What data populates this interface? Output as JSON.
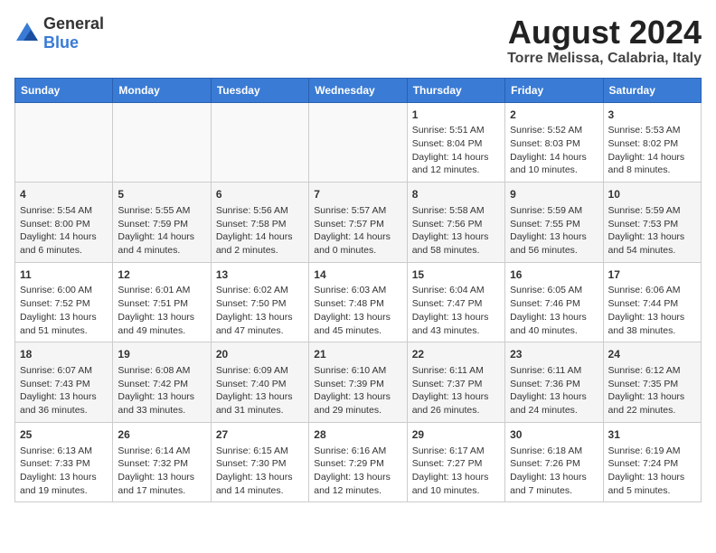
{
  "logo": {
    "general": "General",
    "blue": "Blue"
  },
  "title": "August 2024",
  "subtitle": "Torre Melissa, Calabria, Italy",
  "days_of_week": [
    "Sunday",
    "Monday",
    "Tuesday",
    "Wednesday",
    "Thursday",
    "Friday",
    "Saturday"
  ],
  "weeks": [
    [
      {
        "day": "",
        "content": ""
      },
      {
        "day": "",
        "content": ""
      },
      {
        "day": "",
        "content": ""
      },
      {
        "day": "",
        "content": ""
      },
      {
        "day": "1",
        "content": "Sunrise: 5:51 AM\nSunset: 8:04 PM\nDaylight: 14 hours\nand 12 minutes."
      },
      {
        "day": "2",
        "content": "Sunrise: 5:52 AM\nSunset: 8:03 PM\nDaylight: 14 hours\nand 10 minutes."
      },
      {
        "day": "3",
        "content": "Sunrise: 5:53 AM\nSunset: 8:02 PM\nDaylight: 14 hours\nand 8 minutes."
      }
    ],
    [
      {
        "day": "4",
        "content": "Sunrise: 5:54 AM\nSunset: 8:00 PM\nDaylight: 14 hours\nand 6 minutes."
      },
      {
        "day": "5",
        "content": "Sunrise: 5:55 AM\nSunset: 7:59 PM\nDaylight: 14 hours\nand 4 minutes."
      },
      {
        "day": "6",
        "content": "Sunrise: 5:56 AM\nSunset: 7:58 PM\nDaylight: 14 hours\nand 2 minutes."
      },
      {
        "day": "7",
        "content": "Sunrise: 5:57 AM\nSunset: 7:57 PM\nDaylight: 14 hours\nand 0 minutes."
      },
      {
        "day": "8",
        "content": "Sunrise: 5:58 AM\nSunset: 7:56 PM\nDaylight: 13 hours\nand 58 minutes."
      },
      {
        "day": "9",
        "content": "Sunrise: 5:59 AM\nSunset: 7:55 PM\nDaylight: 13 hours\nand 56 minutes."
      },
      {
        "day": "10",
        "content": "Sunrise: 5:59 AM\nSunset: 7:53 PM\nDaylight: 13 hours\nand 54 minutes."
      }
    ],
    [
      {
        "day": "11",
        "content": "Sunrise: 6:00 AM\nSunset: 7:52 PM\nDaylight: 13 hours\nand 51 minutes."
      },
      {
        "day": "12",
        "content": "Sunrise: 6:01 AM\nSunset: 7:51 PM\nDaylight: 13 hours\nand 49 minutes."
      },
      {
        "day": "13",
        "content": "Sunrise: 6:02 AM\nSunset: 7:50 PM\nDaylight: 13 hours\nand 47 minutes."
      },
      {
        "day": "14",
        "content": "Sunrise: 6:03 AM\nSunset: 7:48 PM\nDaylight: 13 hours\nand 45 minutes."
      },
      {
        "day": "15",
        "content": "Sunrise: 6:04 AM\nSunset: 7:47 PM\nDaylight: 13 hours\nand 43 minutes."
      },
      {
        "day": "16",
        "content": "Sunrise: 6:05 AM\nSunset: 7:46 PM\nDaylight: 13 hours\nand 40 minutes."
      },
      {
        "day": "17",
        "content": "Sunrise: 6:06 AM\nSunset: 7:44 PM\nDaylight: 13 hours\nand 38 minutes."
      }
    ],
    [
      {
        "day": "18",
        "content": "Sunrise: 6:07 AM\nSunset: 7:43 PM\nDaylight: 13 hours\nand 36 minutes."
      },
      {
        "day": "19",
        "content": "Sunrise: 6:08 AM\nSunset: 7:42 PM\nDaylight: 13 hours\nand 33 minutes."
      },
      {
        "day": "20",
        "content": "Sunrise: 6:09 AM\nSunset: 7:40 PM\nDaylight: 13 hours\nand 31 minutes."
      },
      {
        "day": "21",
        "content": "Sunrise: 6:10 AM\nSunset: 7:39 PM\nDaylight: 13 hours\nand 29 minutes."
      },
      {
        "day": "22",
        "content": "Sunrise: 6:11 AM\nSunset: 7:37 PM\nDaylight: 13 hours\nand 26 minutes."
      },
      {
        "day": "23",
        "content": "Sunrise: 6:11 AM\nSunset: 7:36 PM\nDaylight: 13 hours\nand 24 minutes."
      },
      {
        "day": "24",
        "content": "Sunrise: 6:12 AM\nSunset: 7:35 PM\nDaylight: 13 hours\nand 22 minutes."
      }
    ],
    [
      {
        "day": "25",
        "content": "Sunrise: 6:13 AM\nSunset: 7:33 PM\nDaylight: 13 hours\nand 19 minutes."
      },
      {
        "day": "26",
        "content": "Sunrise: 6:14 AM\nSunset: 7:32 PM\nDaylight: 13 hours\nand 17 minutes."
      },
      {
        "day": "27",
        "content": "Sunrise: 6:15 AM\nSunset: 7:30 PM\nDaylight: 13 hours\nand 14 minutes."
      },
      {
        "day": "28",
        "content": "Sunrise: 6:16 AM\nSunset: 7:29 PM\nDaylight: 13 hours\nand 12 minutes."
      },
      {
        "day": "29",
        "content": "Sunrise: 6:17 AM\nSunset: 7:27 PM\nDaylight: 13 hours\nand 10 minutes."
      },
      {
        "day": "30",
        "content": "Sunrise: 6:18 AM\nSunset: 7:26 PM\nDaylight: 13 hours\nand 7 minutes."
      },
      {
        "day": "31",
        "content": "Sunrise: 6:19 AM\nSunset: 7:24 PM\nDaylight: 13 hours\nand 5 minutes."
      }
    ]
  ]
}
